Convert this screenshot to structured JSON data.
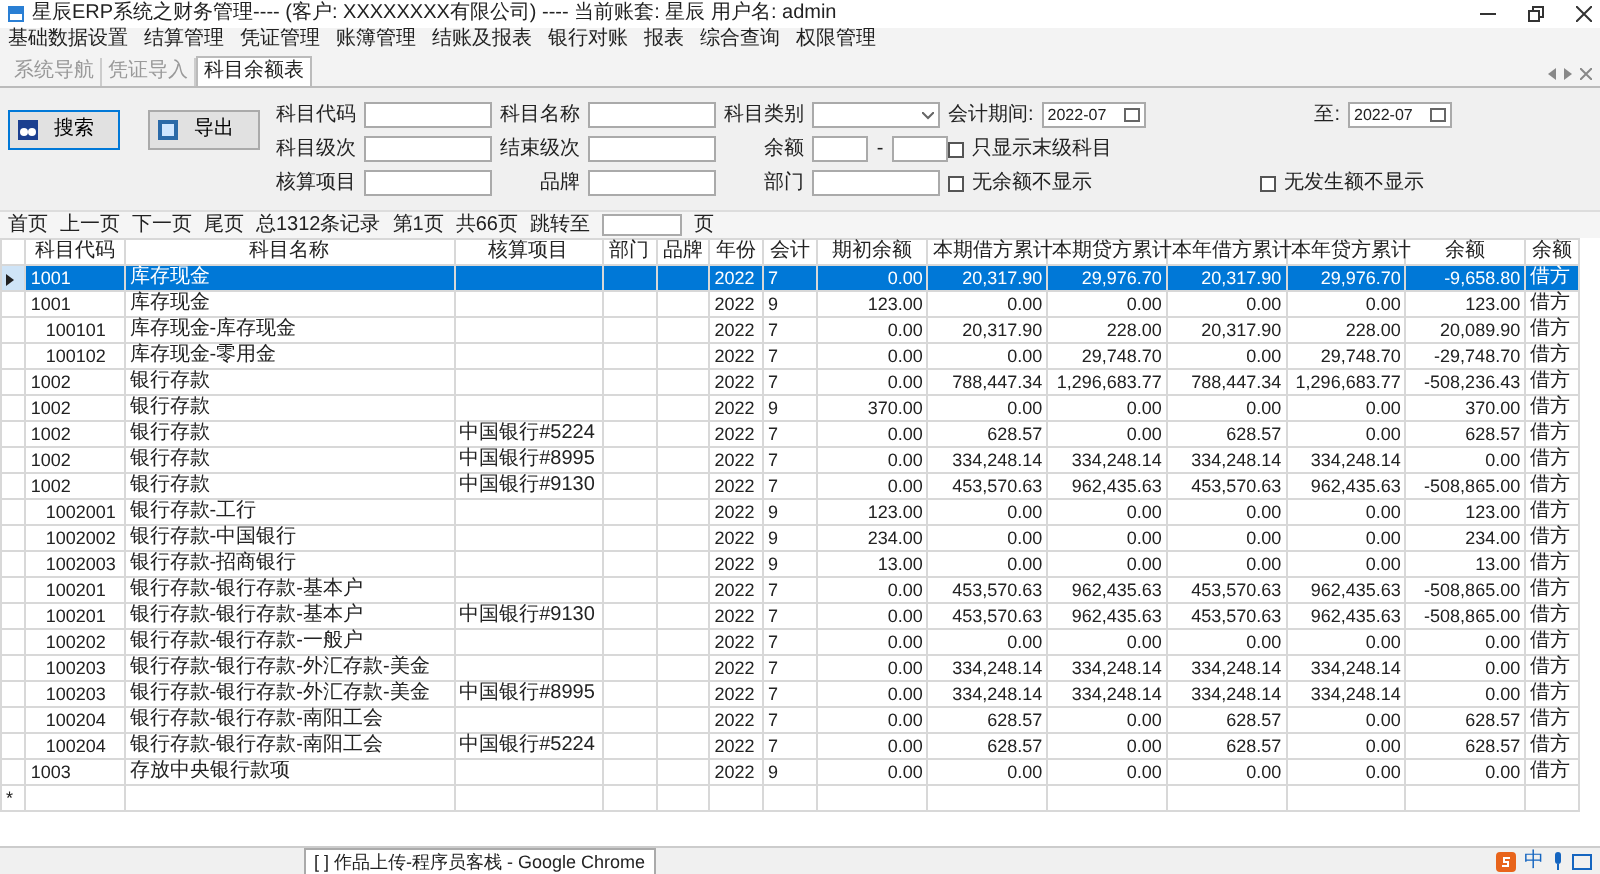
{
  "window": {
    "title": "星辰ERP系统之财务管理---- (客户: XXXXXXXX有限公司) ---- 当前账套: 星辰 用户名: admin"
  },
  "menu": [
    "基础数据设置",
    "结算管理",
    "凭证管理",
    "账簿管理",
    "结账及报表",
    "银行对账",
    "报表",
    "综合查询",
    "权限管理"
  ],
  "tabs": [
    {
      "label": "系统导航",
      "selected": false
    },
    {
      "label": "凭证导入",
      "selected": false
    },
    {
      "label": "科目余额表",
      "selected": true
    }
  ],
  "buttons": [
    "搜索",
    "导出"
  ],
  "filters": [
    [
      {
        "kind": "text",
        "label": "科目代码"
      },
      {
        "kind": "text",
        "label": "科目名称"
      },
      {
        "kind": "select",
        "label": "科目类别"
      },
      {
        "kind": "date",
        "label": "会计期间:",
        "value": "2022-07"
      },
      {
        "kind": "date",
        "label": "至:",
        "value": "2022-07"
      }
    ],
    [
      {
        "kind": "text",
        "label": "科目级次"
      },
      {
        "kind": "text",
        "label": "结束级次"
      },
      {
        "kind": "range",
        "label": "余额",
        "separator": "-"
      },
      {
        "kind": "checkbox",
        "label": "只显示末级科目",
        "checked": false
      }
    ],
    [
      {
        "kind": "text",
        "label": "核算项目"
      },
      {
        "kind": "text",
        "label": "品牌"
      },
      {
        "kind": "text",
        "label": "部门"
      },
      {
        "kind": "checkbox",
        "label": "无余额不显示",
        "checked": false
      },
      {
        "kind": "checkbox",
        "label": "无发生额不显示",
        "checked": false
      }
    ]
  ],
  "pager": {
    "links": [
      "首页",
      "上一页",
      "下一页",
      "尾页"
    ],
    "info": [
      "总1312条记录",
      "第1页",
      "共66页"
    ],
    "jump_label": "跳转至",
    "jump_suffix": "页"
  },
  "table": {
    "columns": [
      "科目代码",
      "科目名称",
      "核算项目",
      "部门",
      "品牌",
      "年份",
      "会计",
      "期初余额",
      "本期借方累计",
      "本期贷方累计",
      "本年借方累计",
      "本年贷方累计",
      "余额",
      "余额"
    ],
    "rows": [
      {
        "selected": true,
        "cells": [
          "1001",
          "库存现金",
          "",
          "",
          "",
          "2022",
          "7",
          "0.00",
          "20,317.90",
          "29,976.70",
          "20,317.90",
          "29,976.70",
          "-9,658.80",
          "借方"
        ]
      },
      {
        "selected": false,
        "cells": [
          "1001",
          "库存现金",
          "",
          "",
          "",
          "2022",
          "9",
          "123.00",
          "0.00",
          "0.00",
          "0.00",
          "0.00",
          "123.00",
          "借方"
        ]
      },
      {
        "selected": false,
        "cells": [
          "   100101",
          "库存现金-库存现金",
          "",
          "",
          "",
          "2022",
          "7",
          "0.00",
          "20,317.90",
          "228.00",
          "20,317.90",
          "228.00",
          "20,089.90",
          "借方"
        ]
      },
      {
        "selected": false,
        "cells": [
          "   100102",
          "库存现金-零用金",
          "",
          "",
          "",
          "2022",
          "7",
          "0.00",
          "0.00",
          "29,748.70",
          "0.00",
          "29,748.70",
          "-29,748.70",
          "借方"
        ]
      },
      {
        "selected": false,
        "cells": [
          "1002",
          "银行存款",
          "",
          "",
          "",
          "2022",
          "7",
          "0.00",
          "788,447.34",
          "1,296,683.77",
          "788,447.34",
          "1,296,683.77",
          "-508,236.43",
          "借方"
        ]
      },
      {
        "selected": false,
        "cells": [
          "1002",
          "银行存款",
          "",
          "",
          "",
          "2022",
          "9",
          "370.00",
          "0.00",
          "0.00",
          "0.00",
          "0.00",
          "370.00",
          "借方"
        ]
      },
      {
        "selected": false,
        "cells": [
          "1002",
          "银行存款",
          "中国银行#5224",
          "",
          "",
          "2022",
          "7",
          "0.00",
          "628.57",
          "0.00",
          "628.57",
          "0.00",
          "628.57",
          "借方"
        ]
      },
      {
        "selected": false,
        "cells": [
          "1002",
          "银行存款",
          "中国银行#8995",
          "",
          "",
          "2022",
          "7",
          "0.00",
          "334,248.14",
          "334,248.14",
          "334,248.14",
          "334,248.14",
          "0.00",
          "借方"
        ]
      },
      {
        "selected": false,
        "cells": [
          "1002",
          "银行存款",
          "中国银行#9130",
          "",
          "",
          "2022",
          "7",
          "0.00",
          "453,570.63",
          "962,435.63",
          "453,570.63",
          "962,435.63",
          "-508,865.00",
          "借方"
        ]
      },
      {
        "selected": false,
        "cells": [
          "   1002001",
          "银行存款-工行",
          "",
          "",
          "",
          "2022",
          "9",
          "123.00",
          "0.00",
          "0.00",
          "0.00",
          "0.00",
          "123.00",
          "借方"
        ]
      },
      {
        "selected": false,
        "cells": [
          "   1002002",
          "银行存款-中国银行",
          "",
          "",
          "",
          "2022",
          "9",
          "234.00",
          "0.00",
          "0.00",
          "0.00",
          "0.00",
          "234.00",
          "借方"
        ]
      },
      {
        "selected": false,
        "cells": [
          "   1002003",
          "银行存款-招商银行",
          "",
          "",
          "",
          "2022",
          "9",
          "13.00",
          "0.00",
          "0.00",
          "0.00",
          "0.00",
          "13.00",
          "借方"
        ]
      },
      {
        "selected": false,
        "cells": [
          "   100201",
          "银行存款-银行存款-基本户",
          "",
          "",
          "",
          "2022",
          "7",
          "0.00",
          "453,570.63",
          "962,435.63",
          "453,570.63",
          "962,435.63",
          "-508,865.00",
          "借方"
        ]
      },
      {
        "selected": false,
        "cells": [
          "   100201",
          "银行存款-银行存款-基本户",
          "中国银行#9130",
          "",
          "",
          "2022",
          "7",
          "0.00",
          "453,570.63",
          "962,435.63",
          "453,570.63",
          "962,435.63",
          "-508,865.00",
          "借方"
        ]
      },
      {
        "selected": false,
        "cells": [
          "   100202",
          "银行存款-银行存款-一般户",
          "",
          "",
          "",
          "2022",
          "7",
          "0.00",
          "0.00",
          "0.00",
          "0.00",
          "0.00",
          "0.00",
          "借方"
        ]
      },
      {
        "selected": false,
        "cells": [
          "   100203",
          "银行存款-银行存款-外汇存款-美金",
          "",
          "",
          "",
          "2022",
          "7",
          "0.00",
          "334,248.14",
          "334,248.14",
          "334,248.14",
          "334,248.14",
          "0.00",
          "借方"
        ]
      },
      {
        "selected": false,
        "cells": [
          "   100203",
          "银行存款-银行存款-外汇存款-美金",
          "中国银行#8995",
          "",
          "",
          "2022",
          "7",
          "0.00",
          "334,248.14",
          "334,248.14",
          "334,248.14",
          "334,248.14",
          "0.00",
          "借方"
        ]
      },
      {
        "selected": false,
        "cells": [
          "   100204",
          "银行存款-银行存款-南阳工会",
          "",
          "",
          "",
          "2022",
          "7",
          "0.00",
          "628.57",
          "0.00",
          "628.57",
          "0.00",
          "628.57",
          "借方"
        ]
      },
      {
        "selected": false,
        "cells": [
          "   100204",
          "银行存款-银行存款-南阳工会",
          "中国银行#5224",
          "",
          "",
          "2022",
          "7",
          "0.00",
          "628.57",
          "0.00",
          "628.57",
          "0.00",
          "628.57",
          "借方"
        ]
      },
      {
        "selected": false,
        "cells": [
          "1003",
          "存放中央银行款项",
          "",
          "",
          "",
          "2022",
          "9",
          "0.00",
          "0.00",
          "0.00",
          "0.00",
          "0.00",
          "0.00",
          "借方"
        ]
      }
    ],
    "new_row_marker": "*"
  },
  "taskbar": {
    "item": "[        ] 作品上传-程序员客栈 - Google Chrome",
    "ime": "中"
  }
}
